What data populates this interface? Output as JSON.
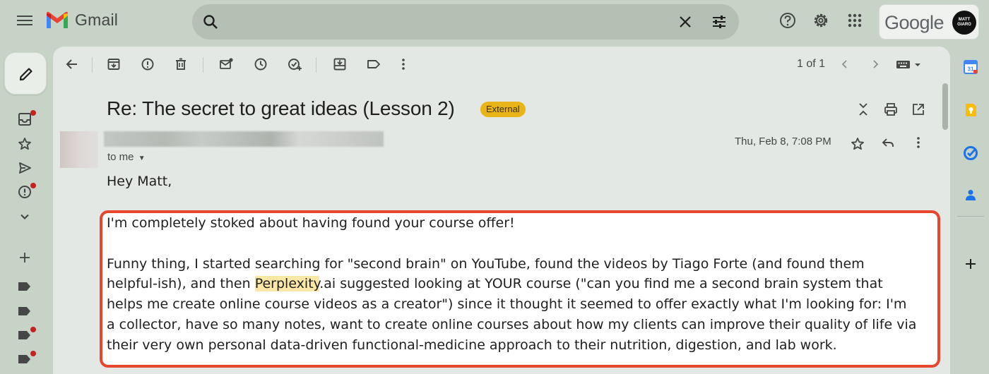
{
  "app": {
    "name": "Gmail"
  },
  "account": {
    "brand": "Google",
    "avatar_lines": [
      "MATT",
      "GIARO"
    ]
  },
  "toolbar": {
    "pager": "1 of 1"
  },
  "email": {
    "subject": "Re: The secret to great ideas (Lesson 2)",
    "badge": "External",
    "recipient": "to me",
    "date": "Thu, Feb 8, 7:08 PM",
    "greeting": "Hey Matt,",
    "body_lines": {
      "l1": "I'm completely stoked about having found your course offer!",
      "l2": "Funny thing, I started searching for \"second brain\" on YouTube, found the videos by Tiago Forte (and found them",
      "l3_pre": "helpful-ish), and then ",
      "l3_hl": "Perplexity",
      "l3_post": ".ai suggested looking at YOUR course (\"can you find me a second brain system that",
      "l4": "helps me create online course videos as a creator\") since it thought it seemed to offer exactly what I'm looking for: I'm",
      "l5": "a collector, have so many notes, want to create online courses about how my clients can improve their quality of life via",
      "l6": "their very own personal data-driven functional-medicine approach to their nutrition, digestion, and lab work."
    }
  },
  "colors": {
    "accent_red": "#e5462d",
    "badge_yellow": "#e8b417",
    "highlight": "#fce8a6",
    "background": "#c6d3c6"
  },
  "icons": {
    "top": [
      "menu-icon",
      "gmail-logo",
      "search-icon",
      "clear-icon",
      "tune-icon",
      "help-icon",
      "settings-icon",
      "apps-icon"
    ],
    "rail": [
      "pencil-icon",
      "inbox-icon",
      "star-icon",
      "send-icon",
      "spam-icon",
      "chevron-down-icon",
      "plus-icon",
      "label-icon"
    ],
    "toolbar": [
      "back-icon",
      "archive-icon",
      "report-icon",
      "delete-icon",
      "mark-unread-icon",
      "snooze-icon",
      "add-task-icon",
      "move-icon",
      "label-icon",
      "more-icon"
    ],
    "right": [
      "calendar-icon",
      "keep-icon",
      "tasks-icon",
      "contacts-icon",
      "plus-icon"
    ]
  }
}
